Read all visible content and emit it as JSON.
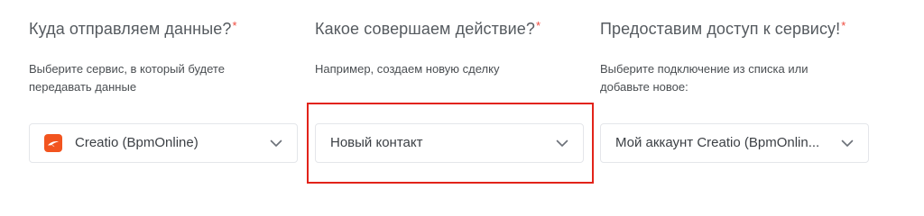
{
  "steps": [
    {
      "title": "Куда отправляем данные?",
      "required_mark": "*",
      "hint": "Выберите сервис, в который будете передавать данные",
      "select": {
        "value": "Creatio (BpmOnline)",
        "icon": "creatio-logo-icon"
      }
    },
    {
      "title": "Какое совершаем действие?",
      "required_mark": "*",
      "hint": "Например, создаем новую сделку",
      "select": {
        "value": "Новый контакт"
      }
    },
    {
      "title": "Предоставим доступ к сервису!",
      "required_mark": "*",
      "hint": "Выберите подключение из списка или добавьте новое:",
      "select": {
        "value": "Мой аккаунт Creatio (BpmOnlin..."
      }
    }
  ],
  "colors": {
    "required": "#ef4b3e",
    "highlight": "#e2231a",
    "brand_logo": "#f2541f",
    "border": "#e4e6ea"
  }
}
